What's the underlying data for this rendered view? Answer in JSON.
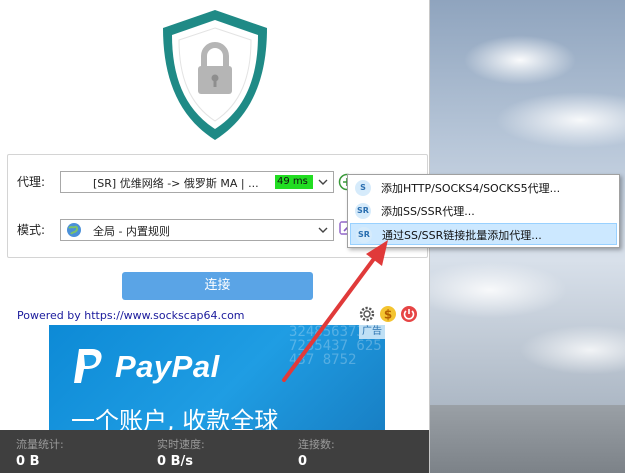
{
  "proxy": {
    "label": "代理:",
    "selected": "[SR] 优维网络 -> 俄罗斯 MA | ...",
    "latency": "49 ms"
  },
  "mode": {
    "label": "模式:",
    "selected": "全局 - 内置规则"
  },
  "connect_button": "连接",
  "powered_by": "Powered by https://www.sockscap64.com",
  "ad": {
    "tag": "广告",
    "brand": "PayPal",
    "slogan": "一个账户, 收款全球",
    "stripe_text": "324856373 87235437 625437 8752"
  },
  "status": {
    "traffic_label": "流量统计:",
    "traffic_value": "0 B",
    "speed_label": "实时速度:",
    "speed_value": "0 B/s",
    "connections_label": "连接数:",
    "connections_value": "0"
  },
  "context_menu": {
    "items": [
      {
        "icon_text": "S",
        "label": "添加HTTP/SOCKS4/SOCKS5代理..."
      },
      {
        "icon_text": "SR",
        "label": "添加SS/SSR代理..."
      },
      {
        "icon_text": "SR",
        "label": "通过SS/SSR链接批量添加代理..."
      }
    ]
  },
  "colors": {
    "connect": "#5aa4e6",
    "latency_ok": "#22dd22",
    "shield": "#1f8a86",
    "paypal_blue": "#1f9de3",
    "status_bar": "#3f3f3f",
    "menu_highlight": "#cce8ff"
  }
}
